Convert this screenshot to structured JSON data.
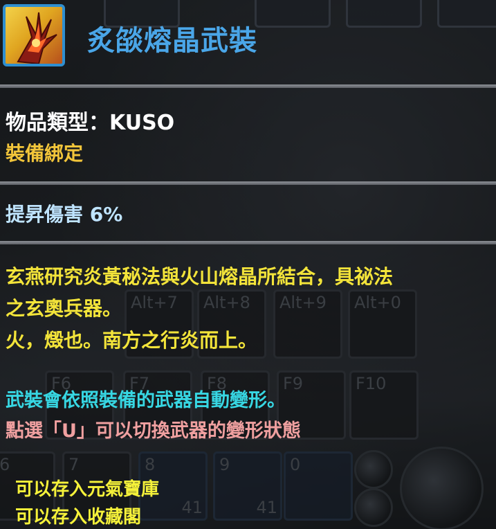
{
  "item": {
    "name": "炙燄熔晶武裝",
    "type_label": "物品類型：KUSO",
    "bind": "裝備綁定",
    "stat": "提昇傷害 6%",
    "lore": [
      "玄燕研究炎黃秘法與火山熔晶所結合，具祕法",
      "之玄奧兵器。",
      "火，燬也。南方之行炎而上。"
    ],
    "notes": [
      "武裝會依照裝備的武器自動變形。",
      "點選「U」可以切換武器的變形狀態"
    ],
    "storage": [
      "可以存入元氣寶庫",
      "可以存入收藏閣"
    ]
  },
  "background": {
    "hotkeys_row1": [
      "Alt+7",
      "Alt+8",
      "Alt+9",
      "Alt+0"
    ],
    "hotkeys_row2": [
      "F6",
      "F7",
      "F8",
      "F9",
      "F10"
    ],
    "slot_row3": [
      "6",
      "7",
      "8",
      "9",
      "0"
    ],
    "stack_counts": [
      "41",
      "41"
    ]
  },
  "colors": {
    "title": "#4aa6e8",
    "bind": "#f2c53a",
    "lore": "#f3e43a",
    "note": "#37d7e3",
    "note_alt": "#f0a0a0",
    "storage": "#f6f23a"
  }
}
